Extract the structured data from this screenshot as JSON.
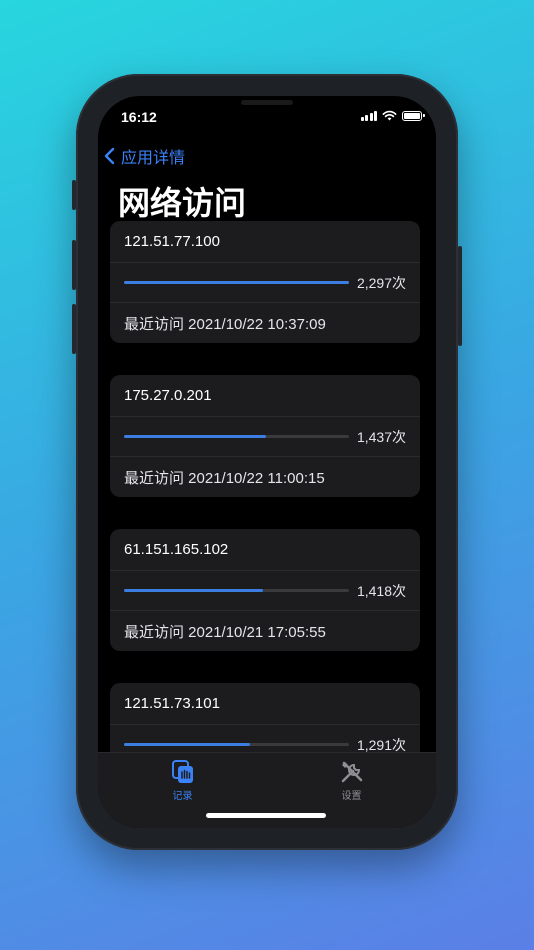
{
  "status_bar": {
    "time": "16:12"
  },
  "nav": {
    "back_label": "应用详情",
    "title": "网络访问"
  },
  "records": [
    {
      "ip": "121.51.77.100",
      "count": "2,297次",
      "ratio": 1.0,
      "recent": "最近访问 2021/10/22 10:37:09"
    },
    {
      "ip": "175.27.0.201",
      "count": "1,437次",
      "ratio": 0.63,
      "recent": "最近访问 2021/10/22 11:00:15"
    },
    {
      "ip": "61.151.165.102",
      "count": "1,418次",
      "ratio": 0.62,
      "recent": "最近访问 2021/10/21 17:05:55"
    },
    {
      "ip": "121.51.73.101",
      "count": "1,291次",
      "ratio": 0.56,
      "recent": ""
    }
  ],
  "tabs": [
    {
      "label": "记录",
      "icon": "records-icon",
      "active": true
    },
    {
      "label": "设置",
      "icon": "tools-icon",
      "active": false
    }
  ],
  "colors": {
    "accent": "#3b82f6",
    "bar": "#3b7de0",
    "card": "#1c1c1e"
  }
}
